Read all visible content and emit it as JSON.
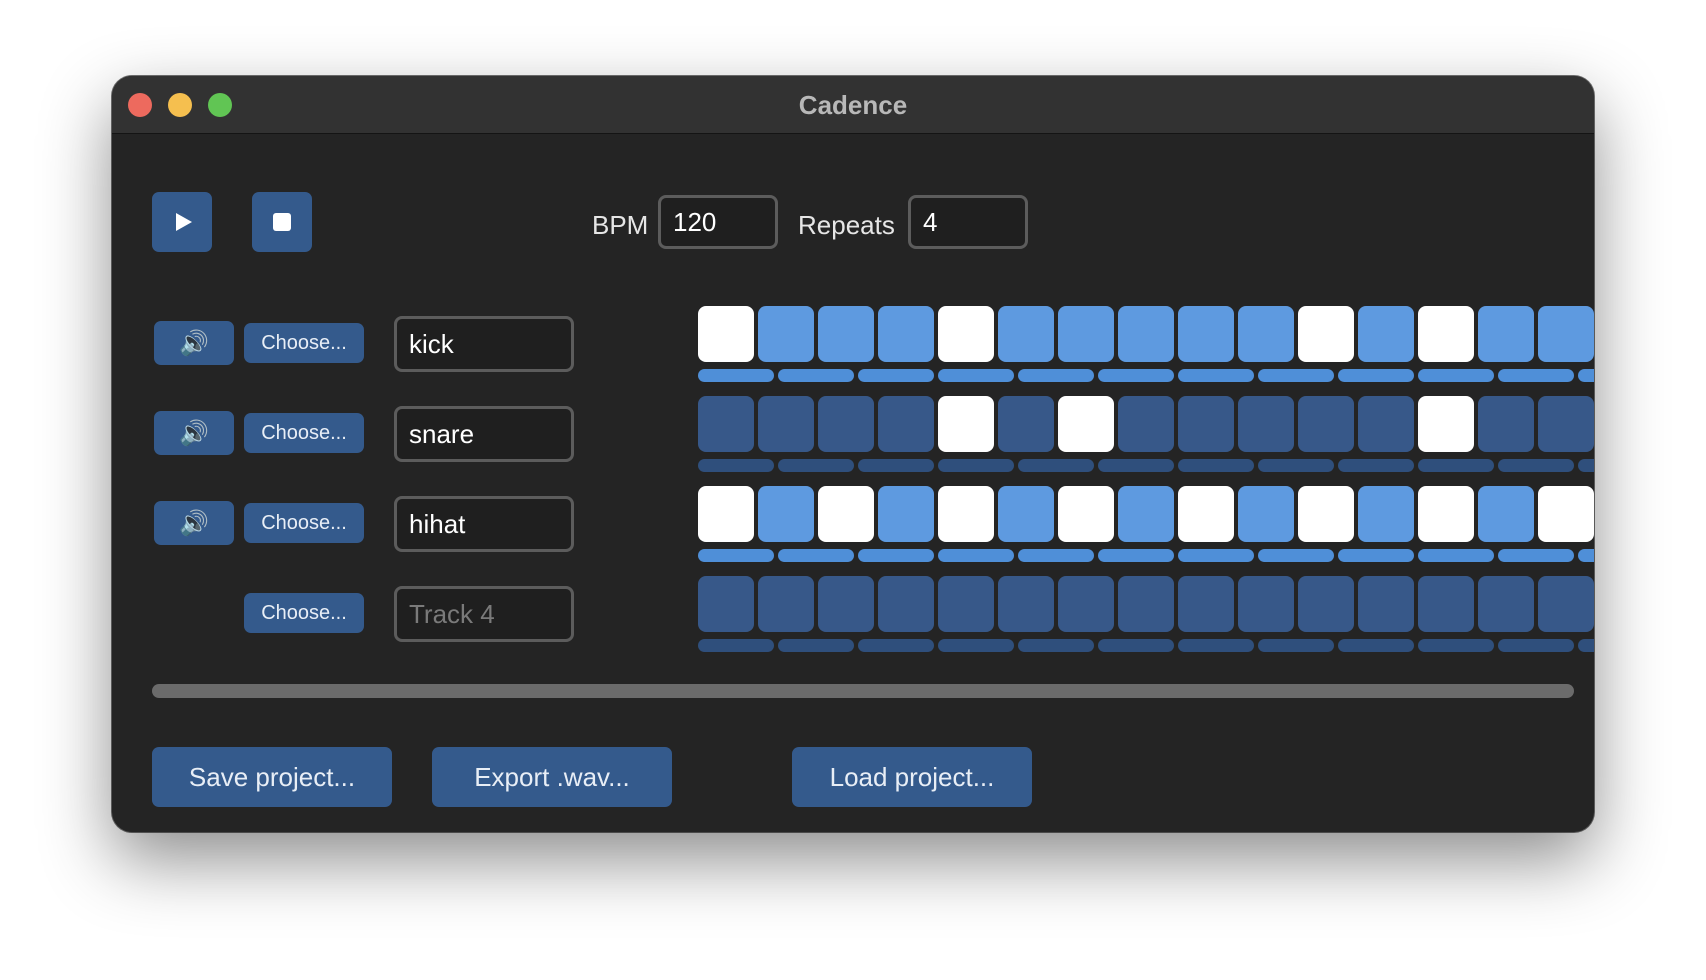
{
  "window": {
    "title": "Cadence"
  },
  "transport": {
    "play_icon": "play-icon",
    "stop_icon": "stop-icon",
    "bpm_label": "BPM",
    "bpm_value": "120",
    "repeats_label": "Repeats",
    "repeats_value": "4"
  },
  "colors": {
    "active_step": "#ffffff",
    "inactive_step_enabled": "#5e9ae0",
    "inactive_step_muted": "#375889",
    "velocity_enabled": "#4f8fd8",
    "velocity_muted": "#2f4f7c",
    "button": "#345a8c"
  },
  "tracks": [
    {
      "has_mute": true,
      "mute_icon": "speaker-icon",
      "choose_label": "Choose...",
      "name": "kick",
      "placeholder": "",
      "enabled": true,
      "steps": [
        1,
        0,
        0,
        0,
        1,
        0,
        0,
        0,
        0,
        0,
        1,
        0,
        1,
        0,
        0,
        0,
        0
      ]
    },
    {
      "has_mute": true,
      "mute_icon": "speaker-icon",
      "choose_label": "Choose...",
      "name": "snare",
      "placeholder": "",
      "enabled": false,
      "steps": [
        0,
        0,
        0,
        0,
        1,
        0,
        1,
        0,
        0,
        0,
        0,
        0,
        1,
        0,
        0,
        0,
        0
      ]
    },
    {
      "has_mute": true,
      "mute_icon": "speaker-icon",
      "choose_label": "Choose...",
      "name": "hihat",
      "placeholder": "",
      "enabled": true,
      "steps": [
        1,
        0,
        1,
        0,
        1,
        0,
        1,
        0,
        1,
        0,
        1,
        0,
        1,
        0,
        1,
        0,
        0
      ]
    },
    {
      "has_mute": false,
      "mute_icon": "",
      "choose_label": "Choose...",
      "name": "",
      "placeholder": "Track 4",
      "enabled": false,
      "steps": [
        0,
        0,
        0,
        0,
        0,
        0,
        0,
        0,
        0,
        0,
        0,
        0,
        0,
        0,
        0,
        0,
        0
      ]
    }
  ],
  "footer": {
    "save_label": "Save project...",
    "export_label": "Export .wav...",
    "load_label": "Load project..."
  }
}
